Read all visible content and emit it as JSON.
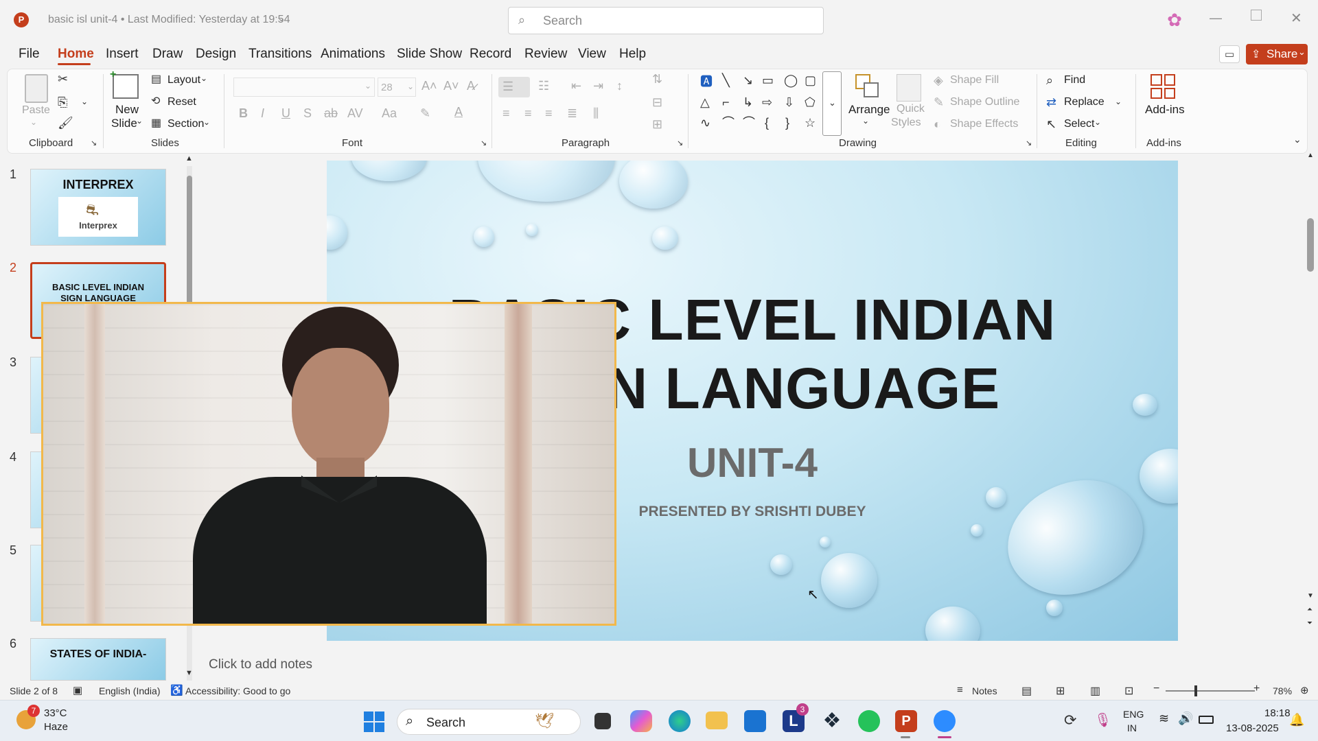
{
  "titlebar": {
    "doc_title": "basic isl unit-4 • Last Modified: Yesterday at 19:54",
    "search_placeholder": "Search"
  },
  "menu": [
    "File",
    "Home",
    "Insert",
    "Draw",
    "Design",
    "Transitions",
    "Animations",
    "Slide Show",
    "Record",
    "Review",
    "View",
    "Help"
  ],
  "share_label": "Share",
  "ribbon": {
    "clipboard": {
      "paste": "Paste",
      "group": "Clipboard"
    },
    "slides": {
      "new_slide_1": "New",
      "new_slide_2": "Slide",
      "layout": "Layout",
      "reset": "Reset",
      "section": "Section",
      "group": "Slides"
    },
    "font": {
      "size": "28",
      "group": "Font"
    },
    "paragraph": {
      "group": "Paragraph"
    },
    "drawing": {
      "arrange": "Arrange",
      "quick_styles_1": "Quick",
      "quick_styles_2": "Styles",
      "shape_fill": "Shape Fill",
      "shape_outline": "Shape Outline",
      "shape_effects": "Shape Effects",
      "group": "Drawing"
    },
    "editing": {
      "find": "Find",
      "replace": "Replace",
      "select": "Select",
      "group": "Editing"
    },
    "addins": {
      "label": "Add-ins",
      "group": "Add-ins"
    }
  },
  "thumbnails": [
    {
      "num": "1",
      "title": "INTERPREX",
      "logo": "Interprex"
    },
    {
      "num": "2",
      "title": "BASIC LEVEL INDIAN SIGN LANGUAGE"
    },
    {
      "num": "3"
    },
    {
      "num": "4"
    },
    {
      "num": "5"
    },
    {
      "num": "6",
      "title": "STATES OF INDIA-"
    }
  ],
  "slide": {
    "title_line1": "BASIC LEVEL INDIAN",
    "title_line2": "SIGN LANGUAGE",
    "unit": "UNIT-4",
    "presenter": "PRESENTED BY SRISHTI DUBEY"
  },
  "notes_placeholder": "Click to add notes",
  "status": {
    "slide_counter": "Slide 2 of 8",
    "language": "English (India)",
    "accessibility": "Accessibility: Good to go",
    "notes": "Notes",
    "zoom": "78%"
  },
  "taskbar": {
    "weather_temp": "33°C",
    "weather_desc": "Haze",
    "weather_badge": "7",
    "search": "Search",
    "lang_1": "ENG",
    "lang_2": "IN",
    "time": "18:18",
    "date": "13-08-2025",
    "l_badge": "3"
  },
  "colors": {
    "accent": "#c43e1c",
    "frame": "#f2b84b",
    "title": "#1a1a1a",
    "unit": "#6b6b6b"
  }
}
